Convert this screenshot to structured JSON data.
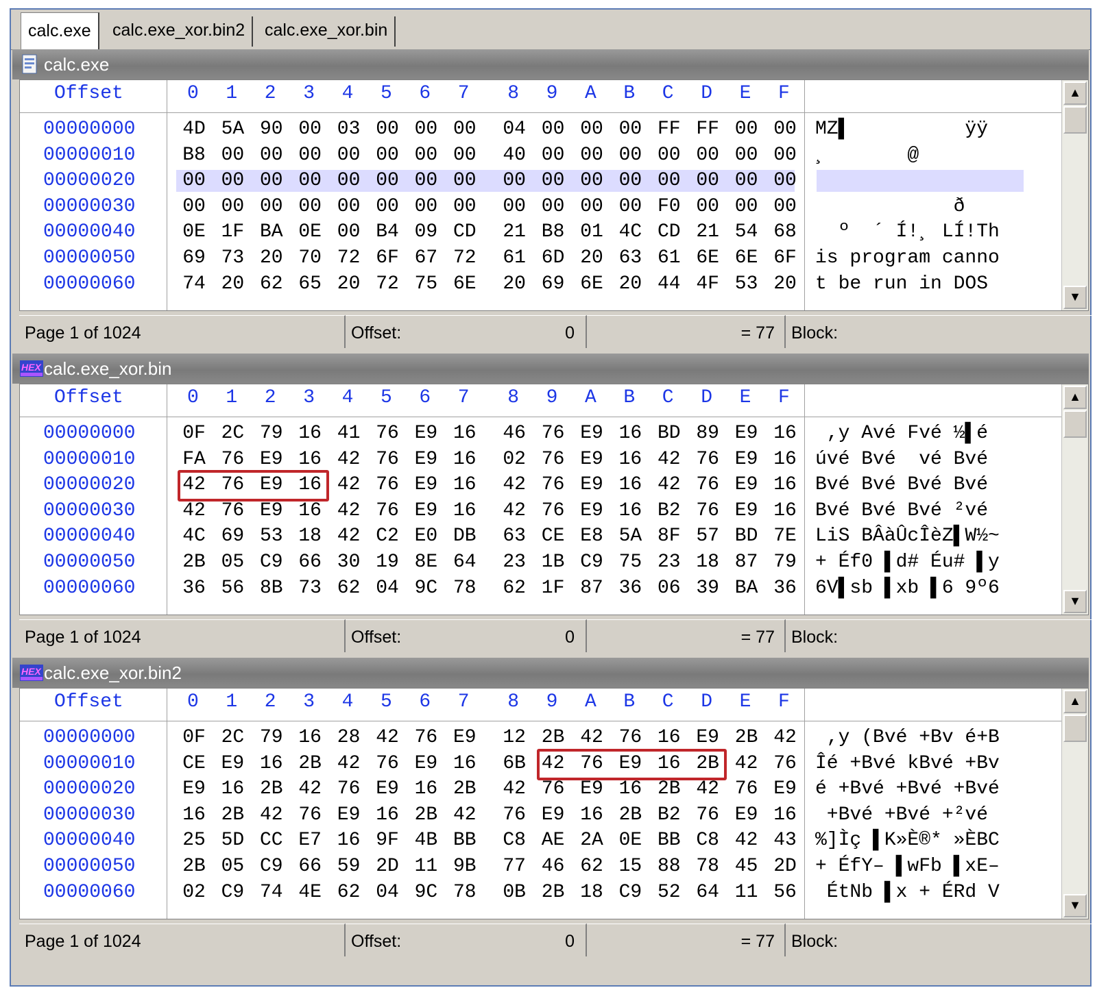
{
  "tabs": [
    {
      "label": "calc.exe",
      "active": true
    },
    {
      "label": "calc.exe_xor.bin2",
      "active": false
    },
    {
      "label": "calc.exe_xor.bin",
      "active": false
    }
  ],
  "columns": {
    "offset_label": "Offset",
    "hex": [
      "0",
      "1",
      "2",
      "3",
      "4",
      "5",
      "6",
      "7",
      "8",
      "9",
      "A",
      "B",
      "C",
      "D",
      "E",
      "F"
    ]
  },
  "colors": {
    "offset_blue": "#1c36e6",
    "highlight_red": "#c0262a",
    "selection": "#dcdcff"
  },
  "panes": [
    {
      "title": "calc.exe",
      "icon": "document-icon",
      "selected_row": 2,
      "rows": [
        {
          "offset": "00000000",
          "bytes": [
            "4D",
            "5A",
            "90",
            "00",
            "03",
            "00",
            "00",
            "00",
            "04",
            "00",
            "00",
            "00",
            "FF",
            "FF",
            "00",
            "00"
          ],
          "ascii": "MZ▌          ÿÿ"
        },
        {
          "offset": "00000010",
          "bytes": [
            "B8",
            "00",
            "00",
            "00",
            "00",
            "00",
            "00",
            "00",
            "40",
            "00",
            "00",
            "00",
            "00",
            "00",
            "00",
            "00"
          ],
          "ascii": "¸       @"
        },
        {
          "offset": "00000020",
          "bytes": [
            "00",
            "00",
            "00",
            "00",
            "00",
            "00",
            "00",
            "00",
            "00",
            "00",
            "00",
            "00",
            "00",
            "00",
            "00",
            "00"
          ],
          "ascii": ""
        },
        {
          "offset": "00000030",
          "bytes": [
            "00",
            "00",
            "00",
            "00",
            "00",
            "00",
            "00",
            "00",
            "00",
            "00",
            "00",
            "00",
            "F0",
            "00",
            "00",
            "00"
          ],
          "ascii": "            ð"
        },
        {
          "offset": "00000040",
          "bytes": [
            "0E",
            "1F",
            "BA",
            "0E",
            "00",
            "B4",
            "09",
            "CD",
            "21",
            "B8",
            "01",
            "4C",
            "CD",
            "21",
            "54",
            "68"
          ],
          "ascii": "  º  ´ Í!¸ LÍ!Th"
        },
        {
          "offset": "00000050",
          "bytes": [
            "69",
            "73",
            "20",
            "70",
            "72",
            "6F",
            "67",
            "72",
            "61",
            "6D",
            "20",
            "63",
            "61",
            "6E",
            "6E",
            "6F"
          ],
          "ascii": "is program canno"
        },
        {
          "offset": "00000060",
          "bytes": [
            "74",
            "20",
            "62",
            "65",
            "20",
            "72",
            "75",
            "6E",
            "20",
            "69",
            "6E",
            "20",
            "44",
            "4F",
            "53",
            "20"
          ],
          "ascii": "t be run in DOS"
        }
      ],
      "status": {
        "page": "Page 1 of 1024",
        "offset_label": "Offset:",
        "offset_value": "0",
        "equals": "= 77",
        "block": "Block:"
      }
    },
    {
      "title": "calc.exe_xor.bin",
      "icon": "hex-editor-icon",
      "highlight": {
        "row": 2,
        "start": 0,
        "end": 3
      },
      "rows": [
        {
          "offset": "00000000",
          "bytes": [
            "0F",
            "2C",
            "79",
            "16",
            "41",
            "76",
            "E9",
            "16",
            "46",
            "76",
            "E9",
            "16",
            "BD",
            "89",
            "E9",
            "16"
          ],
          "ascii": " ,y Avé Fvé ½▌é"
        },
        {
          "offset": "00000010",
          "bytes": [
            "FA",
            "76",
            "E9",
            "16",
            "42",
            "76",
            "E9",
            "16",
            "02",
            "76",
            "E9",
            "16",
            "42",
            "76",
            "E9",
            "16"
          ],
          "ascii": "úvé Bvé  vé Bvé"
        },
        {
          "offset": "00000020",
          "bytes": [
            "42",
            "76",
            "E9",
            "16",
            "42",
            "76",
            "E9",
            "16",
            "42",
            "76",
            "E9",
            "16",
            "42",
            "76",
            "E9",
            "16"
          ],
          "ascii": "Bvé Bvé Bvé Bvé"
        },
        {
          "offset": "00000030",
          "bytes": [
            "42",
            "76",
            "E9",
            "16",
            "42",
            "76",
            "E9",
            "16",
            "42",
            "76",
            "E9",
            "16",
            "B2",
            "76",
            "E9",
            "16"
          ],
          "ascii": "Bvé Bvé Bvé ²vé"
        },
        {
          "offset": "00000040",
          "bytes": [
            "4C",
            "69",
            "53",
            "18",
            "42",
            "C2",
            "E0",
            "DB",
            "63",
            "CE",
            "E8",
            "5A",
            "8F",
            "57",
            "BD",
            "7E"
          ],
          "ascii": "LiS BÂàÛcÎèZ▌W½~"
        },
        {
          "offset": "00000050",
          "bytes": [
            "2B",
            "05",
            "C9",
            "66",
            "30",
            "19",
            "8E",
            "64",
            "23",
            "1B",
            "C9",
            "75",
            "23",
            "18",
            "87",
            "79"
          ],
          "ascii": "+ Éf0 ▌d# Éu# ▌y"
        },
        {
          "offset": "00000060",
          "bytes": [
            "36",
            "56",
            "8B",
            "73",
            "62",
            "04",
            "9C",
            "78",
            "62",
            "1F",
            "87",
            "36",
            "06",
            "39",
            "BA",
            "36"
          ],
          "ascii": "6V▌sb ▌xb ▌6 9º6"
        }
      ],
      "status": {
        "page": "Page 1 of 1024",
        "offset_label": "Offset:",
        "offset_value": "0",
        "equals": "= 77",
        "block": "Block:"
      }
    },
    {
      "title": "calc.exe_xor.bin2",
      "icon": "hex-editor-icon",
      "highlight": {
        "row": 1,
        "start": 9,
        "end": 13
      },
      "rows": [
        {
          "offset": "00000000",
          "bytes": [
            "0F",
            "2C",
            "79",
            "16",
            "28",
            "42",
            "76",
            "E9",
            "12",
            "2B",
            "42",
            "76",
            "16",
            "E9",
            "2B",
            "42"
          ],
          "ascii": " ,y (Bvé +Bv é+B"
        },
        {
          "offset": "00000010",
          "bytes": [
            "CE",
            "E9",
            "16",
            "2B",
            "42",
            "76",
            "E9",
            "16",
            "6B",
            "42",
            "76",
            "E9",
            "16",
            "2B",
            "42",
            "76"
          ],
          "ascii": "Îé +Bvé kBvé +Bv"
        },
        {
          "offset": "00000020",
          "bytes": [
            "E9",
            "16",
            "2B",
            "42",
            "76",
            "E9",
            "16",
            "2B",
            "42",
            "76",
            "E9",
            "16",
            "2B",
            "42",
            "76",
            "E9"
          ],
          "ascii": "é +Bvé +Bvé +Bvé"
        },
        {
          "offset": "00000030",
          "bytes": [
            "16",
            "2B",
            "42",
            "76",
            "E9",
            "16",
            "2B",
            "42",
            "76",
            "E9",
            "16",
            "2B",
            "B2",
            "76",
            "E9",
            "16"
          ],
          "ascii": " +Bvé +Bvé +²vé"
        },
        {
          "offset": "00000040",
          "bytes": [
            "25",
            "5D",
            "CC",
            "E7",
            "16",
            "9F",
            "4B",
            "BB",
            "C8",
            "AE",
            "2A",
            "0E",
            "BB",
            "C8",
            "42",
            "43"
          ],
          "ascii": "%]Ìç ▌K»È®* »ÈBC"
        },
        {
          "offset": "00000050",
          "bytes": [
            "2B",
            "05",
            "C9",
            "66",
            "59",
            "2D",
            "11",
            "9B",
            "77",
            "46",
            "62",
            "15",
            "88",
            "78",
            "45",
            "2D"
          ],
          "ascii": "+ ÉfY– ▌wFb ▌xE–"
        },
        {
          "offset": "00000060",
          "bytes": [
            "02",
            "C9",
            "74",
            "4E",
            "62",
            "04",
            "9C",
            "78",
            "0B",
            "2B",
            "18",
            "C9",
            "52",
            "64",
            "11",
            "56"
          ],
          "ascii": " ÉtNb ▌x + ÉRd V"
        }
      ],
      "status": {
        "page": "Page 1 of 1024",
        "offset_label": "Offset:",
        "offset_value": "0",
        "equals": "= 77",
        "block": "Block:"
      }
    }
  ]
}
